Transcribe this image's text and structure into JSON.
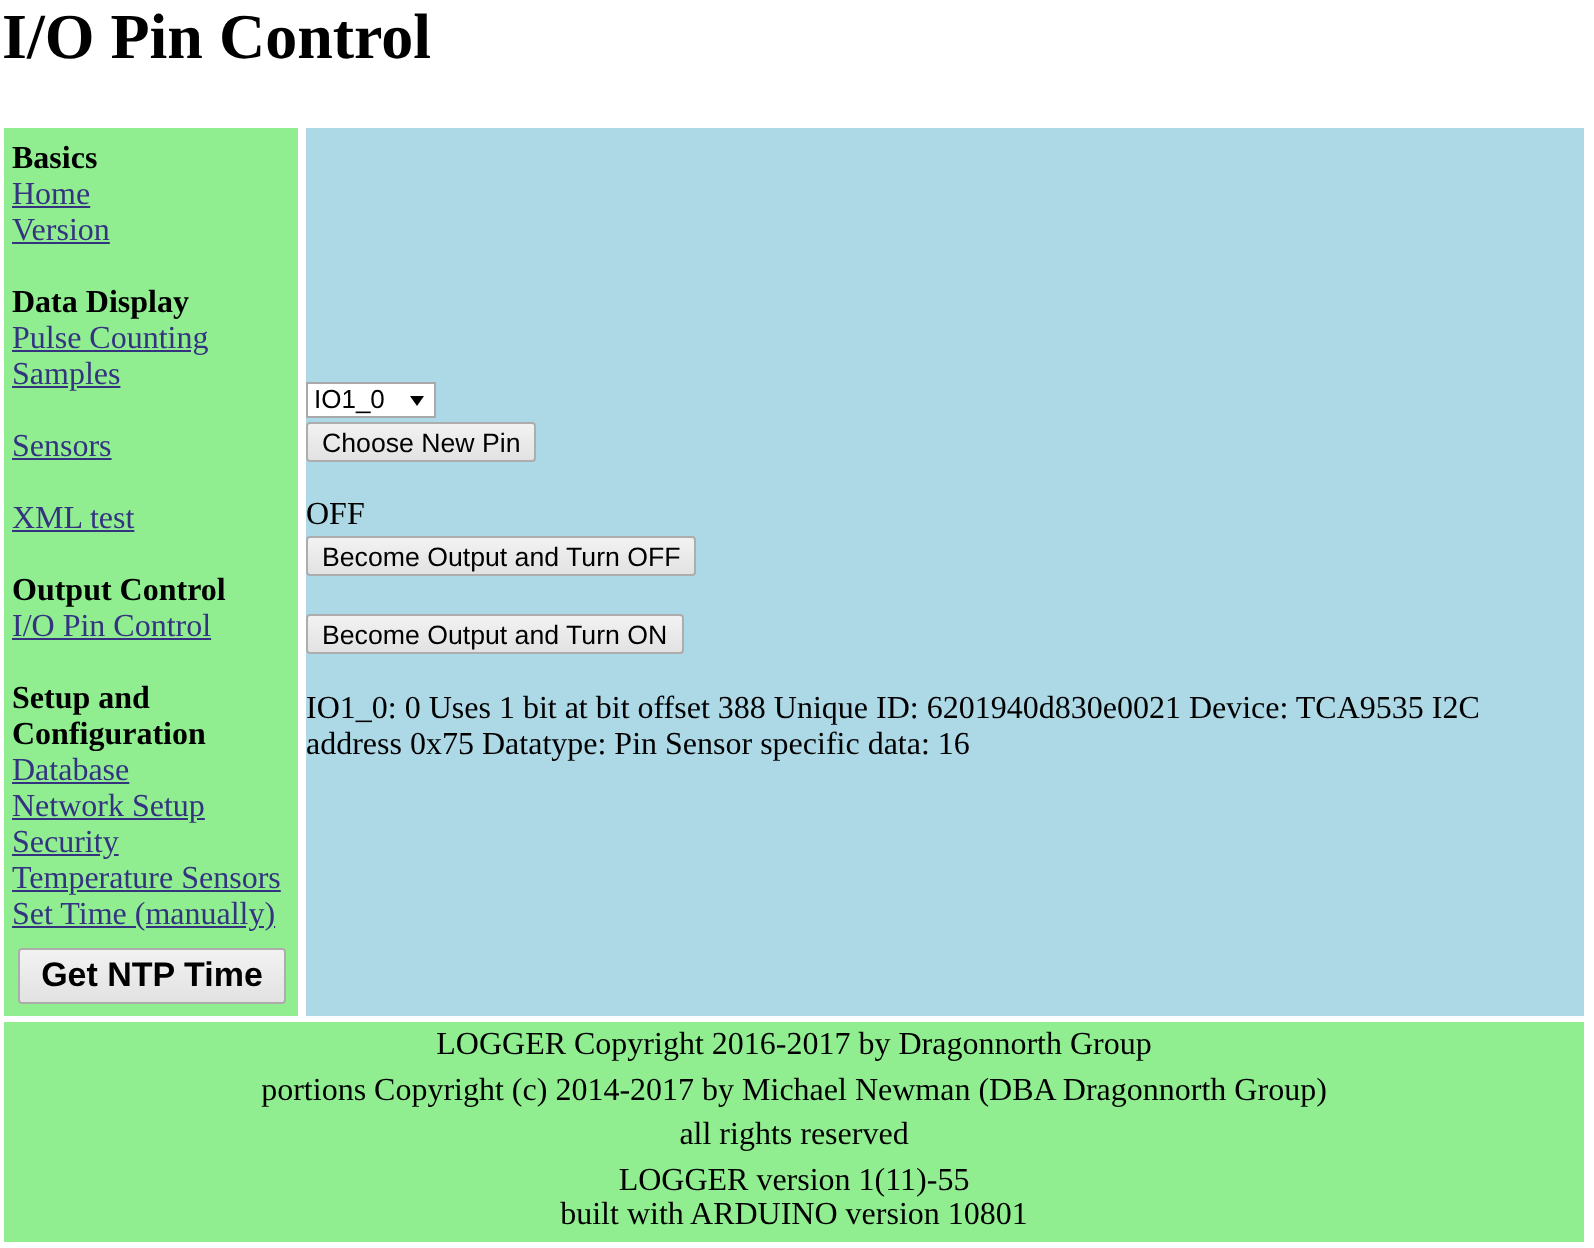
{
  "page": {
    "title": "I/O Pin Control"
  },
  "sidebar": {
    "sections": [
      {
        "heading": "Basics",
        "groups": [
          [
            "Home",
            "Version"
          ]
        ]
      },
      {
        "heading": "Data Display",
        "groups": [
          [
            "Pulse Counting",
            "Samples"
          ],
          [
            "Sensors"
          ],
          [
            "XML test"
          ]
        ]
      },
      {
        "heading": "Output Control",
        "groups": [
          [
            "I/O Pin Control"
          ]
        ]
      },
      {
        "heading": "Setup and Configuration",
        "groups": [
          [
            "Database",
            "Network Setup",
            "Security",
            "Temperature Sensors",
            "Set Time (manually)"
          ]
        ]
      }
    ],
    "button": "Get NTP Time"
  },
  "main": {
    "pin_select": {
      "value": "IO1_0"
    },
    "choose_button": "Choose New Pin",
    "pin_state": "OFF",
    "off_button": "Become Output and Turn OFF",
    "on_button": "Become Output and Turn ON",
    "info": "IO1_0: 0 Uses 1 bit at bit offset 388 Unique ID: 6201940d830e0021 Device: TCA9535 I2C address 0x75 Datatype: Pin Sensor specific data: 16"
  },
  "footer": {
    "copyright_lines": [
      "LOGGER Copyright 2016-2017 by Dragonnorth Group",
      "portions Copyright (c) 2014-2017 by Michael Newman (DBA Dragonnorth Group)",
      "all rights reserved"
    ],
    "version_lines": [
      "LOGGER version 1(11)-55",
      "built with ARDUINO version 10801"
    ]
  }
}
